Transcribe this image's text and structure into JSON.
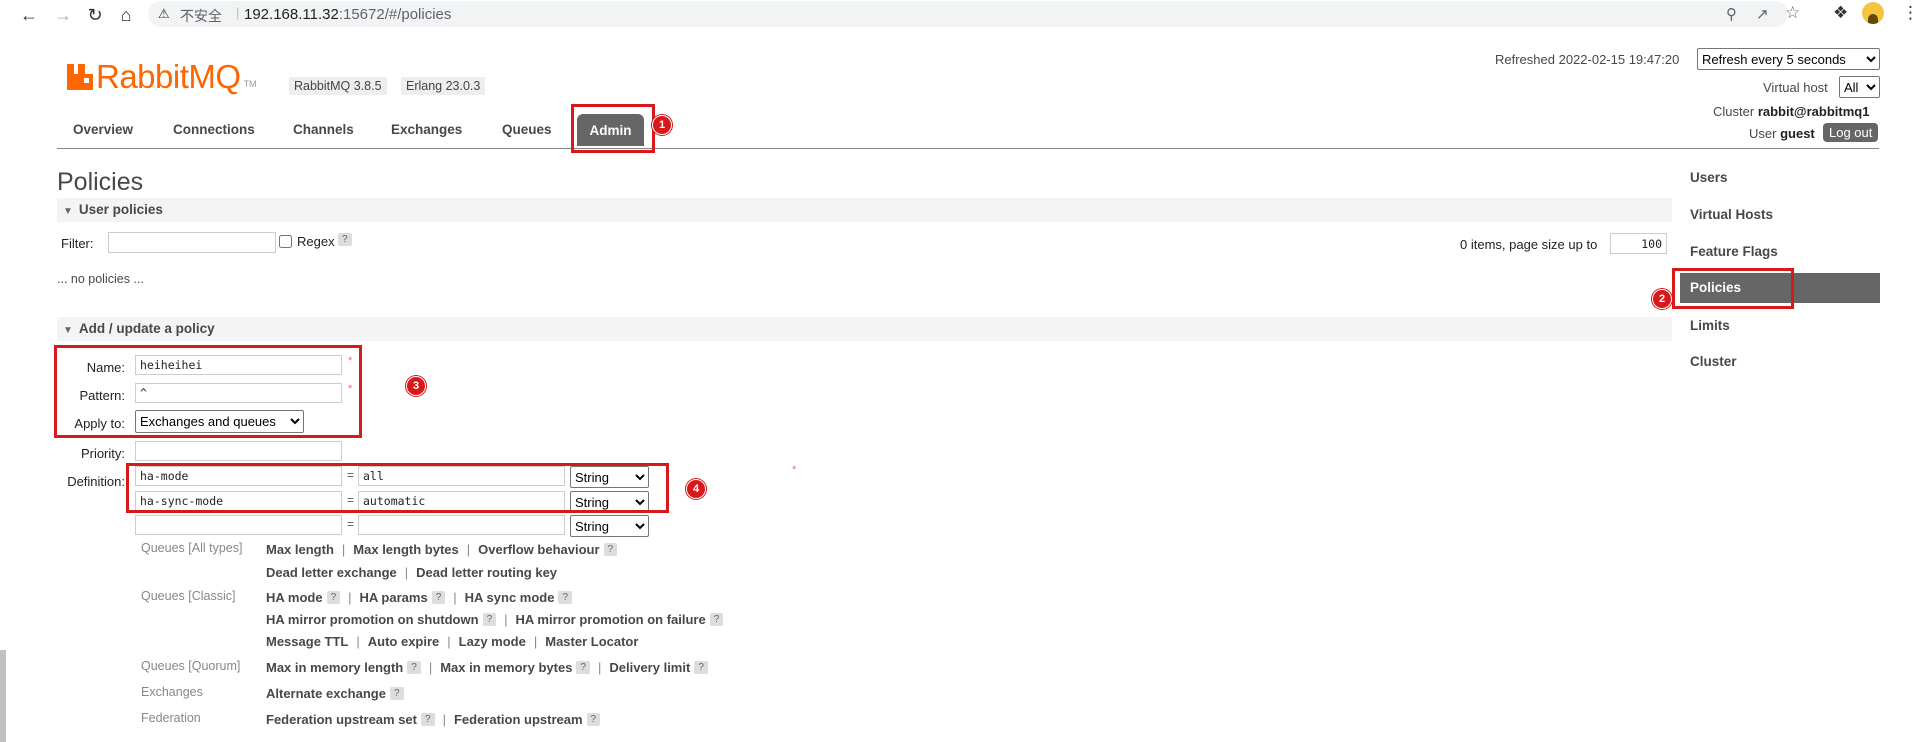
{
  "browser": {
    "insecure_label": "不安全",
    "url_host": "192.168.11.32",
    "url_rest": ":15672/#/policies"
  },
  "header": {
    "logo_word": "RabbitMQ",
    "logo_tm": "TM",
    "rabbit_version": "RabbitMQ 3.8.5",
    "erlang_version": "Erlang 23.0.3",
    "refreshed": "Refreshed 2022-02-15 19:47:20",
    "refresh_option": "Refresh every 5 seconds",
    "vhost_label": "Virtual host",
    "vhost_value": "All",
    "cluster_label": "Cluster",
    "cluster_value": "rabbit@rabbitmq1",
    "user_label": "User",
    "user_value": "guest",
    "logout": "Log out"
  },
  "tabs": [
    "Overview",
    "Connections",
    "Channels",
    "Exchanges",
    "Queues",
    "Admin"
  ],
  "admin_nav": [
    "Users",
    "Virtual Hosts",
    "Feature Flags",
    "Policies",
    "Limits",
    "Cluster"
  ],
  "annotations": [
    "1",
    "2",
    "3",
    "4"
  ],
  "page": {
    "title": "Policies",
    "user_policies": {
      "header": "User policies",
      "filter_label": "Filter:",
      "regex_label": "Regex",
      "help": "?",
      "items_label": "0 items, page size up to",
      "page_size": "100",
      "empty": "... no policies ..."
    },
    "add_policy": {
      "header": "Add / update a policy",
      "name_label": "Name:",
      "name_value": "heiheihei",
      "pattern_label": "Pattern:",
      "pattern_value": "^",
      "apply_label": "Apply to:",
      "apply_value": "Exchanges and queues",
      "priority_label": "Priority:",
      "priority_value": "",
      "definition_label": "Definition:",
      "required_mark": "*",
      "eq": "=",
      "definitions": [
        {
          "key": "ha-mode",
          "value": "all",
          "type": "String"
        },
        {
          "key": "ha-sync-mode",
          "value": "automatic",
          "type": "String"
        },
        {
          "key": "",
          "value": "",
          "type": "String"
        }
      ]
    },
    "categories": {
      "queues_all": "Queues [All types]",
      "queues_all_line1": [
        "Max length",
        "Max length bytes",
        "Overflow behaviour"
      ],
      "queues_all_line2": [
        "Dead letter exchange",
        "Dead letter routing key"
      ],
      "queues_classic": "Queues [Classic]",
      "classic_line1": [
        "HA mode",
        "HA params",
        "HA sync mode"
      ],
      "classic_line2": [
        "HA mirror promotion on shutdown",
        "HA mirror promotion on failure"
      ],
      "classic_line3": [
        "Message TTL",
        "Auto expire",
        "Lazy mode",
        "Master Locator"
      ],
      "queues_quorum": "Queues [Quorum]",
      "quorum_line1": [
        "Max in memory length",
        "Max in memory bytes",
        "Delivery limit"
      ],
      "exchanges": "Exchanges",
      "exchanges_line1": [
        "Alternate exchange"
      ],
      "federation": "Federation",
      "federation_line1": [
        "Federation upstream set",
        "Federation upstream"
      ]
    }
  }
}
